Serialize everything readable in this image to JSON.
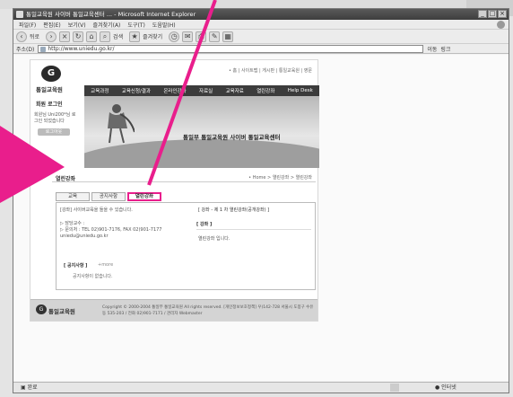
{
  "browser": {
    "title": "통일교육원 사이버 통일교육센터 ... - Microsoft Internet Explorer",
    "menu": [
      "파일(F)",
      "편집(E)",
      "보기(V)",
      "즐겨찾기(A)",
      "도구(T)",
      "도움말(H)"
    ],
    "toolbar": {
      "back_label": "뒤로",
      "search_label": "검색",
      "favorites_label": "즐겨찾기"
    },
    "address_label": "주소(D)",
    "address_value": "http://www.uniedu.go.kr/",
    "go_label": "이동",
    "links_label": "링크",
    "status_left": "완료",
    "status_zone": "인터넷"
  },
  "site": {
    "logo_text": "통일교육원",
    "toplinks": "• 홈 | 사이트맵 | 게시판 | 통일교육원 | 영문",
    "gnb": [
      "교육과정",
      "교육신청/결과",
      "온라인강좌",
      "자료실",
      "교육자료",
      "열린강좌",
      "Help Desk"
    ],
    "login": {
      "title": "회원 로그인",
      "message": "회원님 Uni200*님 로그인 되었습니다",
      "button": "로그아웃"
    },
    "visual_text": "통일부 통일교육원 사이버 통일교육센터",
    "location": "열린강좌",
    "breadcrumb": "• Home > 열린강좌 > 열린강좌",
    "tabs": [
      {
        "label": "교육",
        "active": false
      },
      {
        "label": "공지사항",
        "active": false
      },
      {
        "label": "열린강좌",
        "active": true
      }
    ],
    "panel": {
      "note": "[강좌] 사이버교육을 들을 수 있습니다.",
      "head": "[ 강좌 - 제 1 차 열린강좌(공개강좌) ]",
      "contact_lines": [
        "▷ 담당교수 :",
        "▷ 문의처 : TEL 02)901-7176, FAX 02)901-7177",
        "uniedu@uniedu.go.kr"
      ],
      "title": "[ 강좌 ]",
      "body": "열린강좌 입니다.",
      "sub_title": "[ 공지사항 ]",
      "more": "+more",
      "empty": "공지사항이 없습니다."
    },
    "footer": {
      "logo_text": "통일교육원",
      "text": "Copyright © 2000-2004 통일부 통일교육원 All rights reserved. [개인정보보호정책] 우)142-728 서울시 도봉구 수유동 535-203 / 전화 02)901-7171 / 관리자 Webmaster"
    }
  },
  "accent_color": "#e91e8c"
}
